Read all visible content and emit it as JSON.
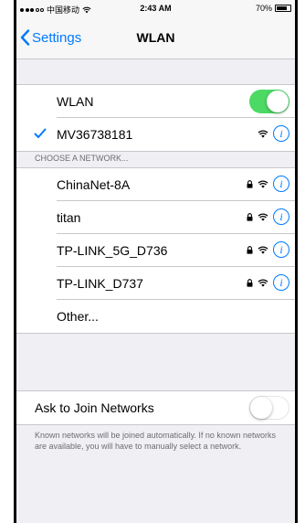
{
  "status_bar": {
    "carrier": "中国移动",
    "time": "2:43 AM",
    "battery": "70%",
    "battery_level": 0.7
  },
  "nav": {
    "back_label": "Settings",
    "title": "WLAN"
  },
  "wlan_toggle": {
    "label": "WLAN",
    "on": true
  },
  "connected_network": {
    "name": "MV36738181"
  },
  "choose_header": "CHOOSE A NETWORK...",
  "networks": [
    {
      "name": "ChinaNet-8A",
      "secured": true
    },
    {
      "name": "titan",
      "secured": true
    },
    {
      "name": "TP-LINK_5G_D736",
      "secured": true
    },
    {
      "name": "TP-LINK_D737",
      "secured": true
    }
  ],
  "other_label": "Other...",
  "ask_to_join": {
    "label": "Ask to Join Networks",
    "on": false,
    "footer": "Known networks will be joined automatically. If no known networks are available, you will have to manually select a network."
  },
  "icons": {
    "lock": "lock-icon",
    "wifi": "wifi-icon",
    "info": "info-icon",
    "check": "checkmark-icon",
    "back": "chevron-left-icon"
  },
  "colors": {
    "accent": "#007aff",
    "toggle_on": "#4cd964",
    "background": "#efeff4"
  }
}
